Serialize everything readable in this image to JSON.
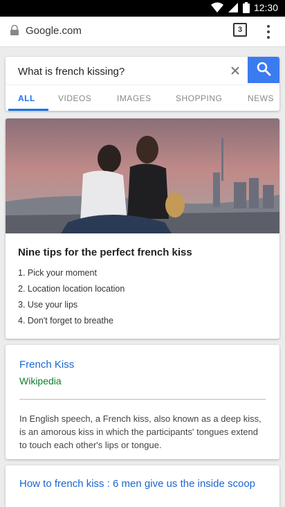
{
  "status_bar": {
    "time": "12:30"
  },
  "browser": {
    "url": "Google.com",
    "tab_count": "3"
  },
  "search": {
    "query": "What is french kissing?",
    "tabs": [
      {
        "label": "ALL",
        "active": true
      },
      {
        "label": "VIDEOS"
      },
      {
        "label": "IMAGES"
      },
      {
        "label": "SHOPPING"
      },
      {
        "label": "NEWS"
      }
    ]
  },
  "featured": {
    "title": "Nine tips for the perfect french kiss",
    "tips": [
      "1. Pick your moment",
      "2. Location location location",
      "3. Use your lips",
      "4. Don't forget to breathe"
    ]
  },
  "wiki_result": {
    "title": "French Kiss",
    "source": "Wikipedia",
    "snippet": "In English speech, a French kiss, also known as a deep kiss, is an amorous kiss in which the participants' tongues extend to touch each other's lips or tongue."
  },
  "next_result": {
    "title": "How to french kiss : 6 men give us the inside scoop"
  },
  "colors": {
    "accent": "#1a73e8",
    "search_button": "#3b7bf0",
    "link": "#1a66d0",
    "source_green": "#0c7d2a"
  }
}
